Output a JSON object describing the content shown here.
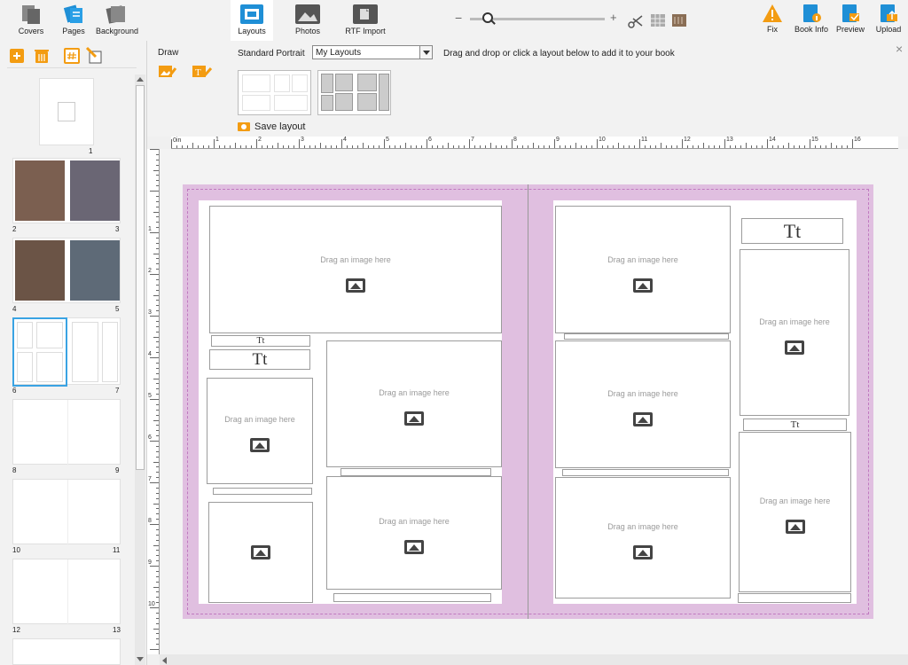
{
  "toolbar": {
    "covers": "Covers",
    "pages": "Pages",
    "background": "Background",
    "layouts": "Layouts",
    "photos": "Photos",
    "rtf_import": "RTF Import",
    "fix": "Fix",
    "book_info": "Book Info",
    "preview": "Preview",
    "upload": "Upload"
  },
  "zoom": {
    "minus": "−",
    "plus": "+",
    "level": 0.2
  },
  "subbar": {
    "draw_label": "Draw",
    "size_label": "Standard Portrait",
    "layout_select_value": "My Layouts",
    "instructions": "Drag and drop or click a layout below to add it to your book",
    "save_layout": "Save layout",
    "close": "×"
  },
  "pages": {
    "numbers": [
      "1",
      "2",
      "3",
      "4",
      "5",
      "6",
      "7",
      "8",
      "9",
      "10",
      "11",
      "12",
      "13"
    ]
  },
  "ruler": {
    "unit": "0in",
    "ticks": [
      "1",
      "2",
      "3",
      "4",
      "5",
      "6",
      "7",
      "8",
      "9",
      "10",
      "11",
      "12",
      "13",
      "14",
      "15",
      "16"
    ]
  },
  "ruler_left": {
    "ticks": [
      "1",
      "2",
      "3",
      "4",
      "5",
      "6",
      "7",
      "8",
      "9",
      "10"
    ]
  },
  "placeholder": {
    "image_text": "Drag an image here",
    "title_text": "Tt"
  },
  "colors": {
    "accent": "#1f8fd6",
    "spread_bg": "#e0bfe0",
    "orange": "#f39c12"
  }
}
